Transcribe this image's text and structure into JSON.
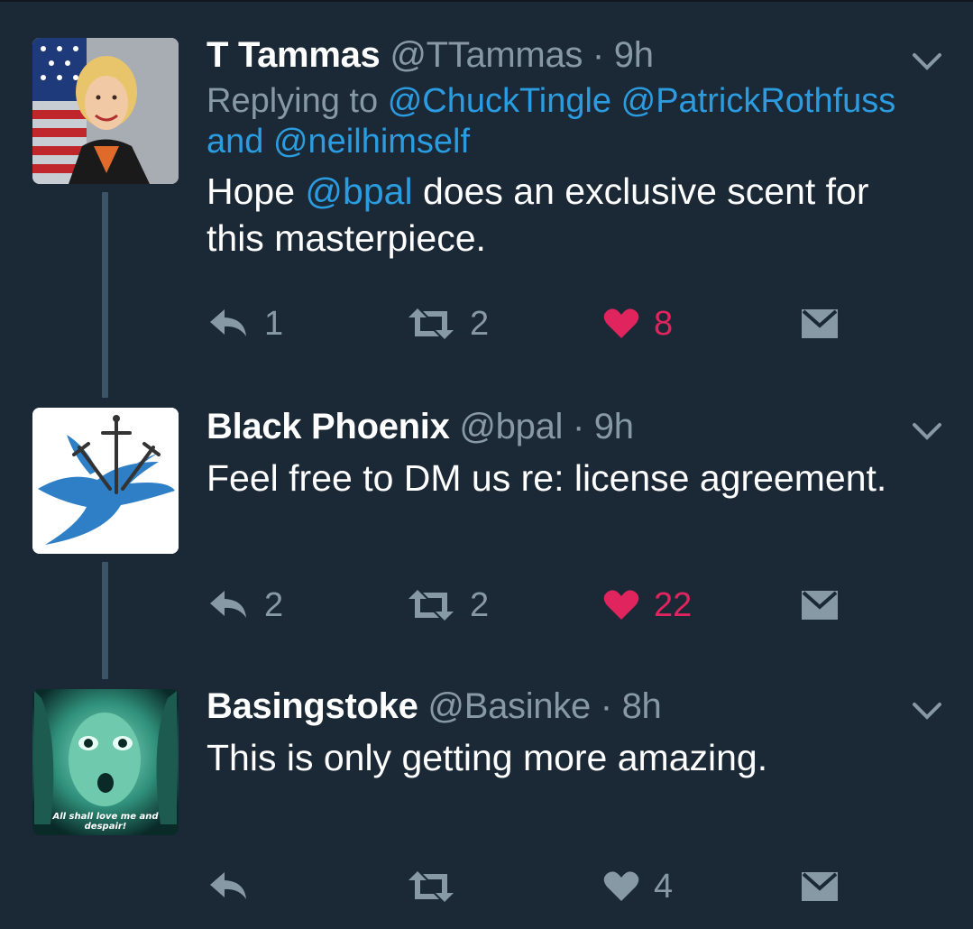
{
  "tweets": [
    {
      "name": "T Tammas",
      "handle": "@TTammas",
      "time": "9h",
      "replying_prefix": "Replying to",
      "replying_to": [
        "@ChuckTingle",
        "@PatrickRothfuss"
      ],
      "replying_and": "and",
      "replying_last": "@neilhimself",
      "text_before": "Hope",
      "mention": "@bpal",
      "text_after": "does an exclusive scent for this masterpiece.",
      "reply_count": "1",
      "retweet_count": "2",
      "like_count": "8",
      "liked": true,
      "avatar_icon": "profile-photo-woman-flag"
    },
    {
      "name": "Black Phoenix",
      "handle": "@bpal",
      "time": "9h",
      "text": "Feel free to DM us re: license agreement.",
      "reply_count": "2",
      "retweet_count": "2",
      "like_count": "22",
      "liked": true,
      "avatar_icon": "bluebird-with-swords-logo"
    },
    {
      "name": "Basingstoke",
      "handle": "@Basinke",
      "time": "8h",
      "text": "This is only getting more amazing.",
      "reply_count": "",
      "retweet_count": "",
      "like_count": "4",
      "liked": false,
      "avatar_caption": "All shall love me and despair!",
      "avatar_icon": "green-glowing-face"
    }
  ],
  "colors": {
    "background": "#1b2836",
    "link": "#2b9ce0",
    "muted": "#8899a6",
    "like": "#e0245e",
    "thread_line": "#3d5466"
  }
}
